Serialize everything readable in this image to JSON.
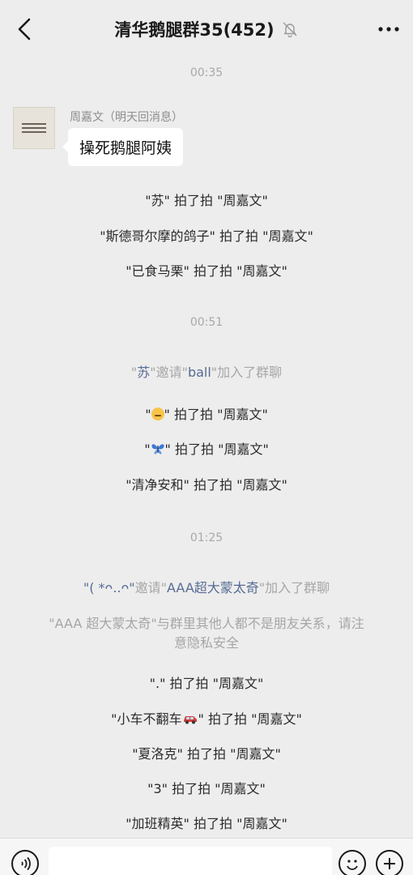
{
  "header": {
    "back_icon": "chevron-left-icon",
    "title": "清华鹅腿群35(452)",
    "mute_icon": "bell-off-icon",
    "more_icon": "more-dots-icon"
  },
  "messages": {
    "time1": "00:35",
    "sender": "周嘉文（明天回消息）",
    "bubble_text": "操死鹅腿阿姨",
    "pat1": "\"苏\" 拍了拍 \"周嘉文\"",
    "pat2": "\"斯德哥尔摩的鸽子\" 拍了拍 \"周嘉文\"",
    "pat3": "\"已食马栗\" 拍了拍 \"周嘉文\"",
    "time2": "00:51",
    "invite1": {
      "q1": "\"",
      "name1": "苏",
      "mid": "\"邀请\"",
      "name2": "ball",
      "tail": "\"加入了群聊"
    },
    "pat4": {
      "pre": "\"",
      "emoji": "smirk-face-emoji",
      "post": "\" 拍了拍 \"周嘉文\""
    },
    "pat5": {
      "pre": "\"",
      "emoji": "butterfly-emoji",
      "post": "\" 拍了拍 \"周嘉文\""
    },
    "pat6": "\"清净安和\" 拍了拍 \"周嘉文\"",
    "time3": "01:25",
    "invite2": {
      "name1": "\"( *ᴖ..ᴖ\"",
      "mid": "邀请\"",
      "name2": "AAA超大蒙太奇",
      "tail": "\"加入了群聊"
    },
    "notice_line1": "\"AAA 超大蒙太奇\"与群里其他人都不是朋友关系，请注",
    "notice_line2": "意隐私安全",
    "pat7": "\".\" 拍了拍 \"周嘉文\"",
    "pat8": {
      "pre": "\"小车不翻车",
      "emoji": "car-emoji",
      "post": "\" 拍了拍 \"周嘉文\""
    },
    "pat9": "\"夏洛克\" 拍了拍 \"周嘉文\"",
    "pat10": "\"3\" 拍了拍 \"周嘉文\"",
    "pat11": "\"加班精英\" 拍了拍 \"周嘉文\""
  },
  "footer": {
    "voice_icon": "voice-icon",
    "emoji_icon": "emoji-icon",
    "plus_icon": "plus-icon"
  },
  "colors": {
    "background": "#ededed",
    "link": "#576b95",
    "gray_text": "#a6a6a6"
  }
}
